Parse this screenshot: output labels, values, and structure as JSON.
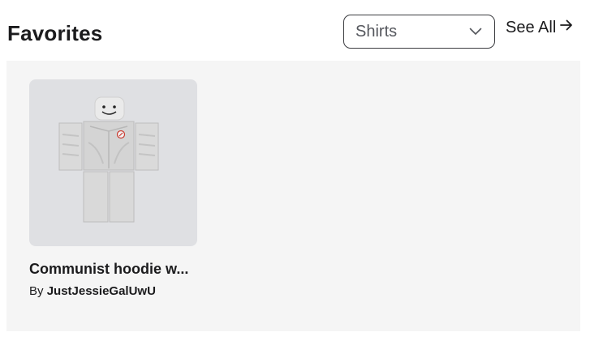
{
  "favorites": {
    "title": "Favorites",
    "filter_value": "Shirts",
    "see_all_label": "See All"
  },
  "items": [
    {
      "name": "Communist hoodie w...",
      "by_label": "By",
      "creator": "JustJessieGalUwU"
    }
  ],
  "icons": {
    "dropdown": "chevron-down-icon",
    "see_all": "arrow-right-icon"
  }
}
